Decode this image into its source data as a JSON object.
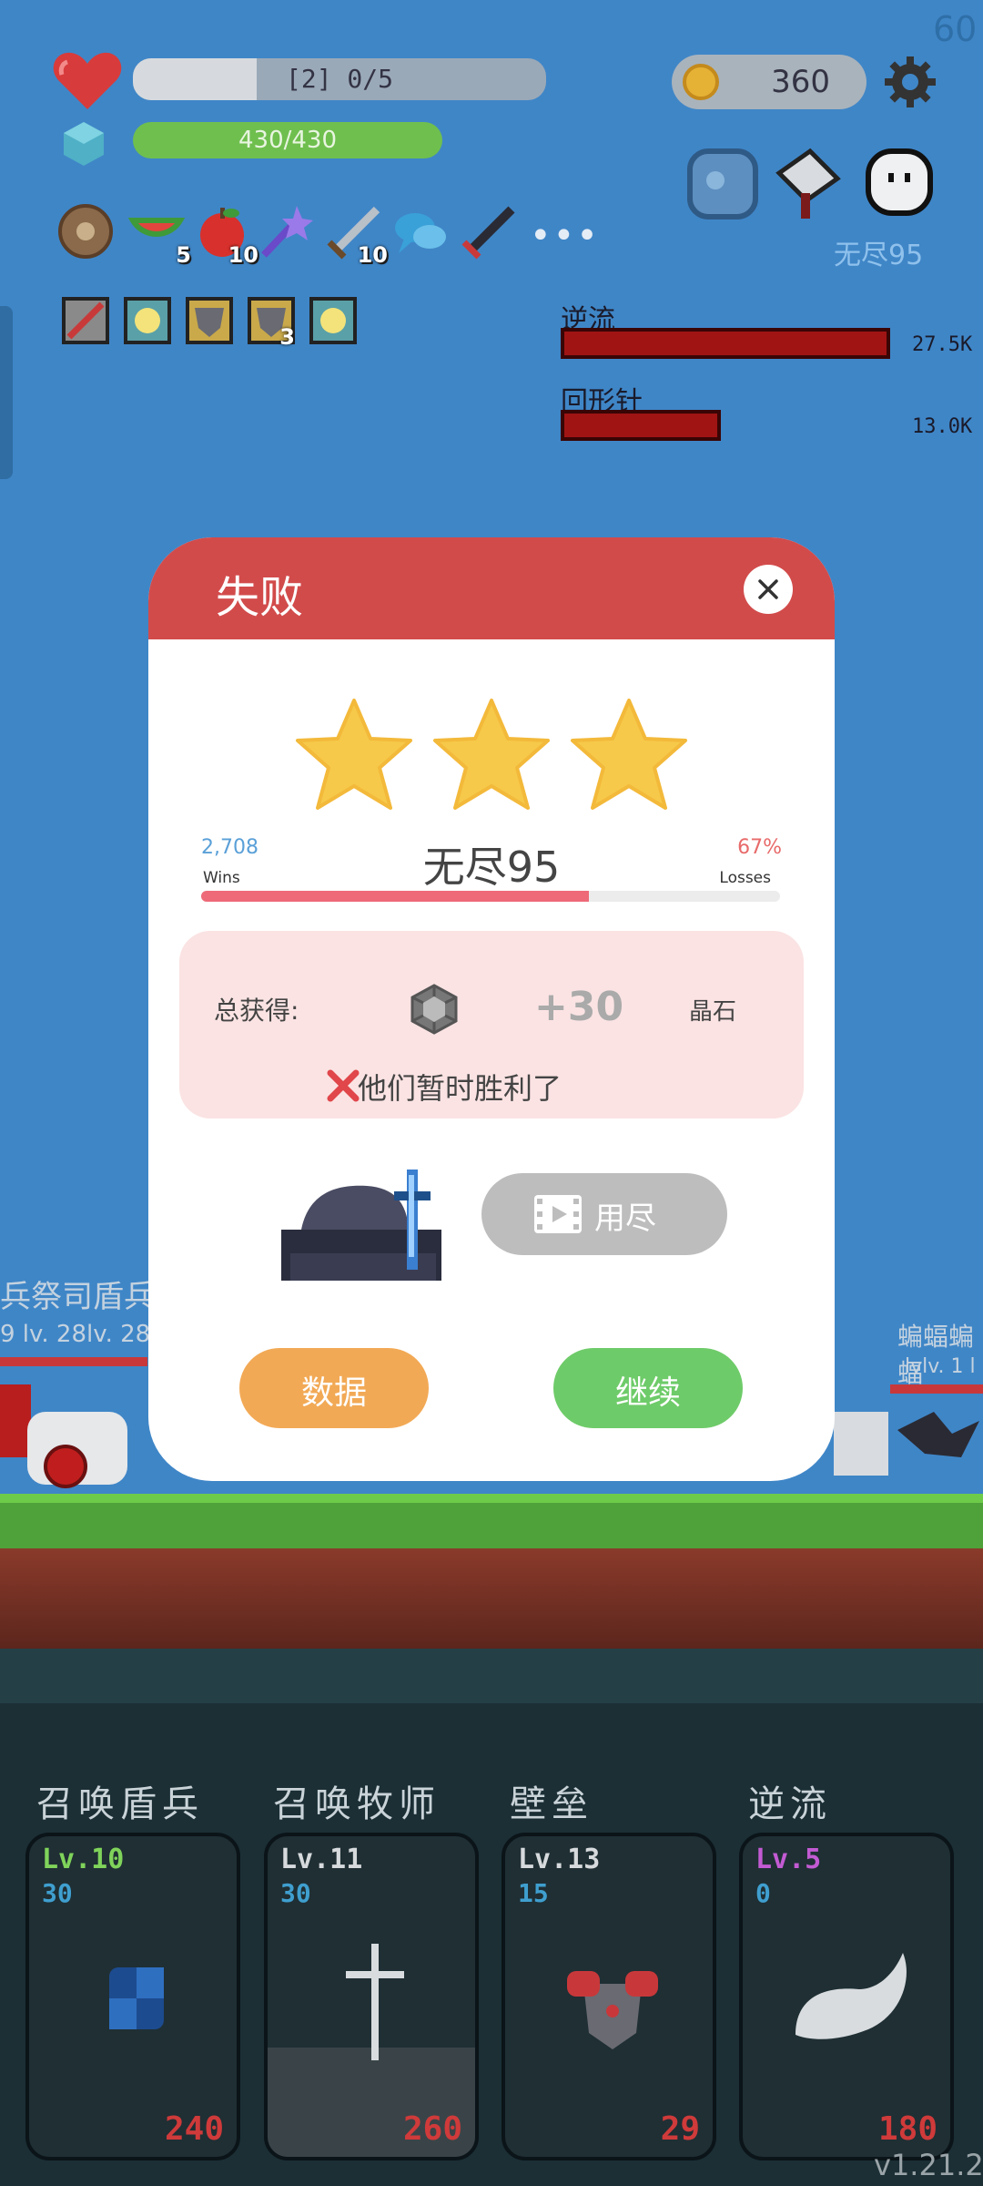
{
  "fps": "60",
  "version": "v1.21.2",
  "hud": {
    "xp_text": "[2] 0/5",
    "xp_fraction": 0.3,
    "hp_text": "430/430",
    "coins": "360"
  },
  "inventory": [
    {
      "icon": "round-shield-icon",
      "count": ""
    },
    {
      "icon": "watermelon-icon",
      "count": "5"
    },
    {
      "icon": "apple-icon",
      "count": "10"
    },
    {
      "icon": "magic-wand-icon",
      "count": ""
    },
    {
      "icon": "sword-icon",
      "count": "10"
    },
    {
      "icon": "speech-bubble-icon",
      "count": ""
    },
    {
      "icon": "dark-sword-icon",
      "count": ""
    }
  ],
  "more_label": "•••",
  "buffs": [
    {
      "icon": "blade-buff-icon",
      "count": ""
    },
    {
      "icon": "light-buff-icon",
      "count": ""
    },
    {
      "icon": "armor-buff-icon",
      "count": ""
    },
    {
      "icon": "armor-buff-icon",
      "count": "3"
    },
    {
      "icon": "light-buff-icon",
      "count": ""
    }
  ],
  "stage_label": "无尽95",
  "boss_bars": [
    {
      "name": "逆流",
      "value": "27.5K",
      "fraction": 1.0
    },
    {
      "name": "回形针",
      "value": "13.0K",
      "fraction": 0.47
    }
  ],
  "modal": {
    "title": "失败",
    "stars": 3,
    "wins_value": "2,708",
    "wins_label": "Wins",
    "losses_value": "67%",
    "losses_label": "Losses",
    "mode_title": "无尽95",
    "progress_fraction": 0.67,
    "reward_label": "总获得:",
    "reward_amount": "+30",
    "reward_unit": "晶石",
    "fail_message": "他们暂时胜利了",
    "video_label": "用尽",
    "data_label": "数据",
    "continue_label": "继续"
  },
  "scene": {
    "left_names": "兵祭司盾兵",
    "left_levels": "9 lv. 28lv. 28",
    "right_names": "蝙蝠蝙蝠",
    "right_levels": "lvlv. 1 l"
  },
  "cards": [
    {
      "title": "召唤盾兵",
      "level": "Lv.10",
      "level_color": "#7fd35a",
      "stat": "30",
      "cost": "240",
      "art": "blue-shield-icon"
    },
    {
      "title": "召唤牧师",
      "level": "Lv.11",
      "level_color": "#d7dadc",
      "stat": "30",
      "cost": "260",
      "art": "cross-icon"
    },
    {
      "title": "壁垒",
      "level": "Lv.13",
      "level_color": "#d7dadc",
      "stat": "15",
      "cost": "29",
      "art": "armor-icon"
    },
    {
      "title": "逆流",
      "level": "Lv.5",
      "level_color": "#c35bd3",
      "stat": "0",
      "cost": "180",
      "art": "wing-icon"
    }
  ]
}
